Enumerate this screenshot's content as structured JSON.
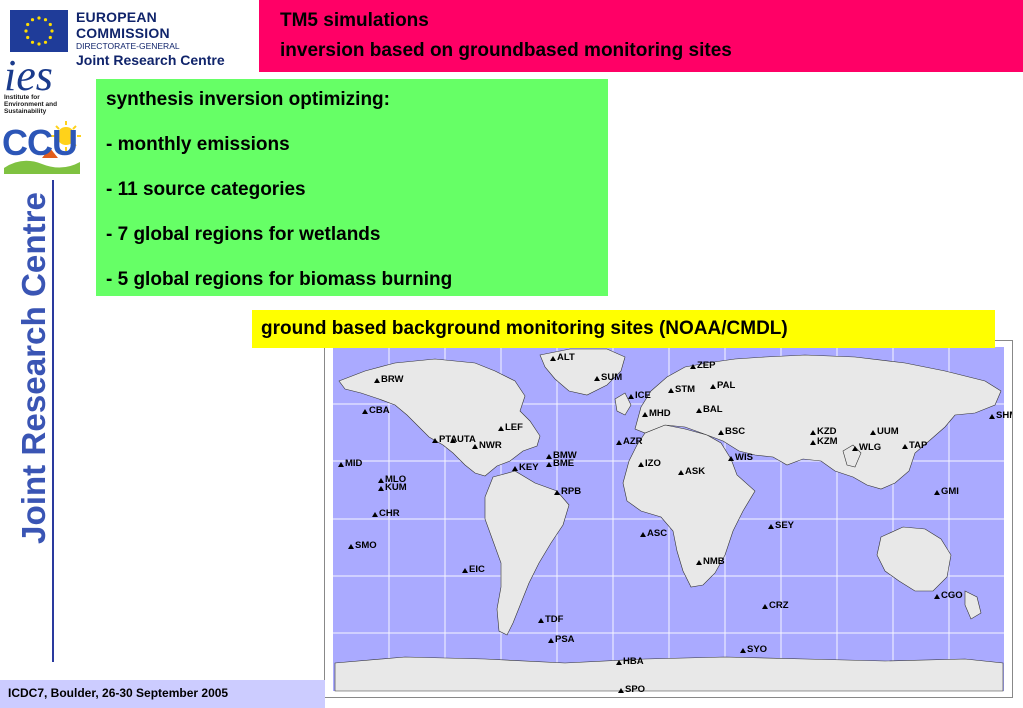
{
  "logo": {
    "title": "EUROPEAN COMMISSION",
    "subtitle": "DIRECTORATE-GENERAL",
    "name": "Joint Research Centre"
  },
  "ies_logo": {
    "word": "ies",
    "caption": [
      "Institute for",
      "Environment and",
      "Sustainability"
    ]
  },
  "ccu_logo": {
    "word": "CCU"
  },
  "vertical_brand": "Joint Research Centre",
  "title": {
    "line1": "TM5 simulations",
    "line2": "inversion based on groundbased monitoring sites"
  },
  "bullets": [
    "synthesis inversion optimizing:",
    "- monthly emissions",
    "- 11 source categories",
    "- 7 global regions for wetlands",
    "- 5 global regions for biomass burning"
  ],
  "map_caption": "ground based background monitoring sites (NOAA/CMDL)",
  "sites": [
    {
      "code": "ALT"
    },
    {
      "code": "ZEP"
    },
    {
      "code": "BRW"
    },
    {
      "code": "SUM"
    },
    {
      "code": "STM"
    },
    {
      "code": "PAL"
    },
    {
      "code": "ICE"
    },
    {
      "code": "CBA"
    },
    {
      "code": "MHD"
    },
    {
      "code": "BAL"
    },
    {
      "code": "SHM"
    },
    {
      "code": "LEF"
    },
    {
      "code": "BSC"
    },
    {
      "code": "KZD"
    },
    {
      "code": "KZM"
    },
    {
      "code": "UUM"
    },
    {
      "code": "PTA"
    },
    {
      "code": "UTA"
    },
    {
      "code": "NWR"
    },
    {
      "code": "AZR"
    },
    {
      "code": "WLG"
    },
    {
      "code": "TAP"
    },
    {
      "code": "MID"
    },
    {
      "code": "BMW"
    },
    {
      "code": "BME"
    },
    {
      "code": "KEY"
    },
    {
      "code": "IZO"
    },
    {
      "code": "WIS"
    },
    {
      "code": "ASK"
    },
    {
      "code": "MLO"
    },
    {
      "code": "KUM"
    },
    {
      "code": "RPB"
    },
    {
      "code": "GMI"
    },
    {
      "code": "CHR"
    },
    {
      "code": "SEY"
    },
    {
      "code": "ASC"
    },
    {
      "code": "SMO"
    },
    {
      "code": "NMB"
    },
    {
      "code": "EIC"
    },
    {
      "code": "CRZ"
    },
    {
      "code": "CGO"
    },
    {
      "code": "TDF"
    },
    {
      "code": "PSA"
    },
    {
      "code": "SYO"
    },
    {
      "code": "HBA"
    },
    {
      "code": "SPO"
    }
  ],
  "footer": "ICDC7, Boulder, 26-30 September 2005",
  "colors": {
    "title_bg": "#ff0066",
    "green_box": "#66ff66",
    "yellow_box": "#ffff00",
    "footer_bg": "#ccccff",
    "ocean": "#aaaaff",
    "land": "#e8e8e8",
    "brand_blue": "#2a3a9f"
  }
}
